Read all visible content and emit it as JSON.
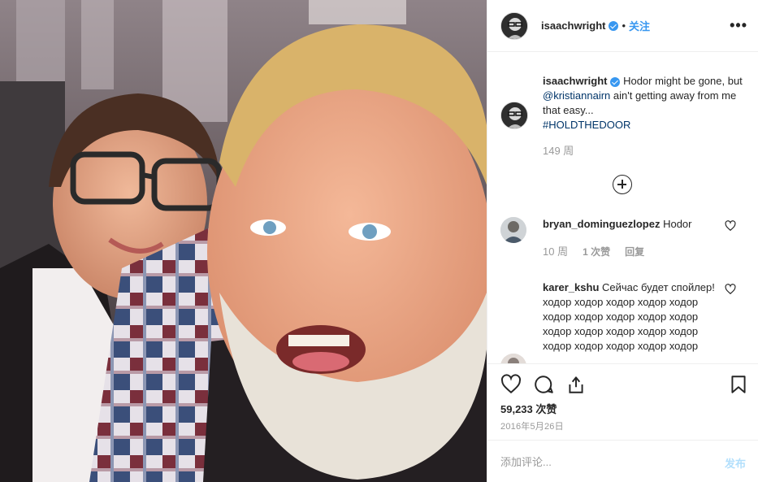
{
  "post": {
    "username": "isaachwright",
    "follow_label": "关注",
    "dot": "•",
    "more_label": "•••",
    "caption": {
      "username": "isaachwright",
      "text_before": " Hodor might be gone, but ",
      "mention": "@kristiannairn",
      "text_after": " ain't getting away from me that easy...",
      "hashtag": "#HOLDTHEDOOR",
      "time": "149 周"
    },
    "comments": [
      {
        "username": "bryan_dominguezlopez",
        "text": " Hodor",
        "time": "10 周",
        "likes": "1 次赞",
        "reply": "回复"
      },
      {
        "username": "karer_kshu",
        "text": " Сейчас будет спойлер!",
        "lines": [
          "ходор ходор ходор ходор ходор",
          "ходор ходор ходор ходор ходор",
          "ходор ходор ходор ходор ходор",
          "ходор ходор ходор ходор ходор"
        ]
      }
    ],
    "likes_count": "59,233 次赞",
    "date": "2016年5月26日",
    "comment_placeholder": "添加评论...",
    "post_button": "发布"
  },
  "colors": {
    "accent": "#3897f0",
    "link": "#003569",
    "muted": "#999999",
    "post_disabled": "#b2dffc"
  },
  "icons": [
    "verified-badge-icon",
    "more-options-icon",
    "load-more-comments-icon",
    "heart-icon",
    "comment-icon",
    "share-icon",
    "bookmark-icon"
  ]
}
